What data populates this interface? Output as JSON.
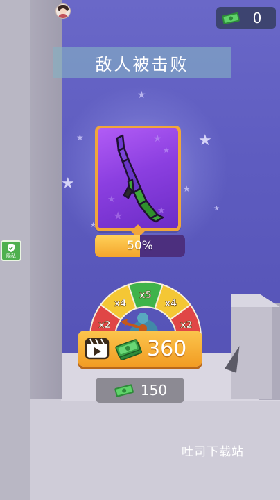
{
  "hud": {
    "cash_count": "0",
    "cash_icon": "cash-bill-icon",
    "avatar_icon": "player-avatar-icon"
  },
  "banner": {
    "title": "敌人被击败"
  },
  "weapon_card": {
    "icon": "bazooka-weapon-icon",
    "unlock_progress": 0.5,
    "progress_label": "50%"
  },
  "side_badge": {
    "label": "隐私",
    "icon": "shield-check-icon"
  },
  "multiplier_wheel": {
    "segments": [
      "x2",
      "x4",
      "x5",
      "x4",
      "x2"
    ],
    "colors": [
      "#e04646",
      "#f4c735",
      "#3fb34a",
      "#f4c735",
      "#e04646"
    ],
    "pointer_icon": "arrow-pointer-icon"
  },
  "reward_button": {
    "amount": "360",
    "video_icon": "video-ad-icon",
    "cash_icon": "cash-stack-icon"
  },
  "skip_button": {
    "amount": "150",
    "cash_icon": "cash-bill-icon"
  },
  "watermark": {
    "text": "吐司下载站"
  },
  "colors": {
    "accent_orange": "#f4a52c",
    "card_purple": "#8b3fe0",
    "wall_purple": "#5e5cc0"
  }
}
